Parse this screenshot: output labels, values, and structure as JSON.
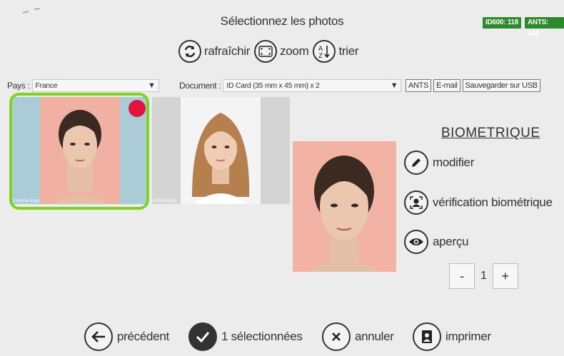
{
  "header": {
    "title": "Sélectionnez les photos",
    "badges": [
      "ID600: 118",
      "ANTS: 444"
    ]
  },
  "toolbar": {
    "refresh": {
      "icon": "refresh-icon",
      "label": "rafraîchir"
    },
    "zoom": {
      "icon": "zoom-icon",
      "label": "zoom"
    },
    "sort": {
      "icon": "sort-az-icon",
      "label": "trier"
    }
  },
  "filters": {
    "country_label": "Pays :",
    "country_value": "France",
    "document_label": "Document :",
    "document_value": "ID Card (35 mm x 45 mm) x 2",
    "buttons": [
      "ANTS",
      "E-mail",
      "Sauvegarder sur USB"
    ]
  },
  "photos": [
    {
      "filename": "D femme 3.jpg",
      "selected": true
    },
    {
      "filename": "id fillette.jpg",
      "selected": false
    }
  ],
  "details": {
    "heading": "BIOMETRIQUE",
    "actions": [
      {
        "icon": "pencil-icon",
        "label": "modifier"
      },
      {
        "icon": "face-scan-icon",
        "label": "vérification biométrique"
      },
      {
        "icon": "eye-icon",
        "label": "aperçu"
      }
    ],
    "quantity": {
      "minus": "-",
      "value": "1",
      "plus": "+"
    }
  },
  "footer": {
    "previous": "précédent",
    "selected": "1 sélectionnées",
    "cancel": "annuler",
    "print": "imprimer"
  },
  "colors": {
    "selection": "#7ed321",
    "selected_dot": "#e0143c",
    "badge_bg": "#2b8a2b",
    "background": "#ececec"
  }
}
